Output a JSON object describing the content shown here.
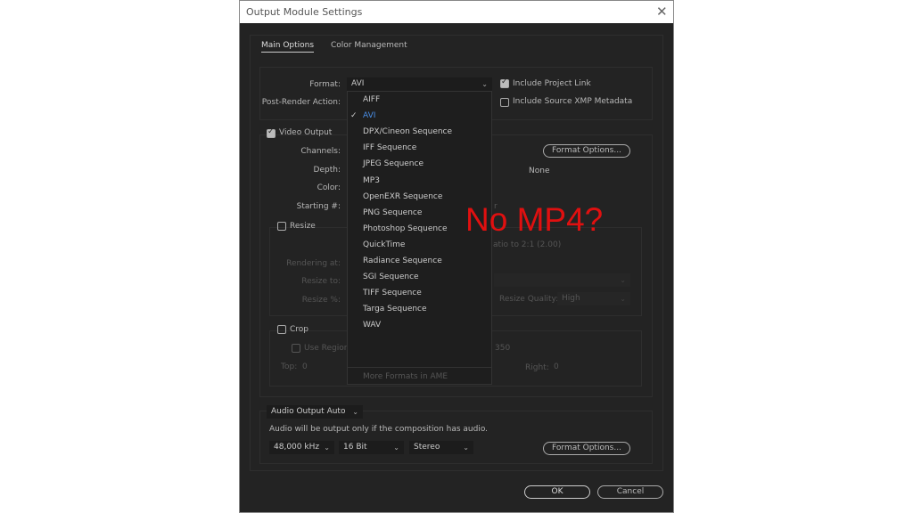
{
  "dialog": {
    "title": "Output Module Settings",
    "close_icon": "close-icon"
  },
  "tabs": [
    {
      "label": "Main Options",
      "active": true
    },
    {
      "label": "Color Management",
      "active": false
    }
  ],
  "format": {
    "label": "Format:",
    "value": "AVI",
    "post_render_label": "Post-Render Action:",
    "include_project_link": {
      "label": "Include Project Link",
      "checked": true
    },
    "include_xmp": {
      "label": "Include Source XMP Metadata",
      "checked": false
    }
  },
  "menu": {
    "items": [
      "AIFF",
      "AVI",
      "DPX/Cineon Sequence",
      "IFF Sequence",
      "JPEG Sequence",
      "MP3",
      "OpenEXR Sequence",
      "PNG Sequence",
      "Photoshop Sequence",
      "QuickTime",
      "Radiance Sequence",
      "SGI Sequence",
      "TIFF Sequence",
      "Targa Sequence",
      "WAV"
    ],
    "selected": "AVI",
    "more": "More Formats in AME"
  },
  "video": {
    "label": "Video Output",
    "checked": true,
    "channels": "Channels:",
    "depth": "Depth:",
    "color": "Color:",
    "starting": "Starting #:",
    "format_options": "Format Options...",
    "none": "None",
    "partial_r": "r"
  },
  "resize": {
    "label": "Resize",
    "checked": false,
    "rendering_at": "Rendering at:",
    "resize_to": "Resize to:",
    "resize_pct": "Resize %:",
    "ratio": "atio to 2:1 (2.00)",
    "quality_label": "Resize Quality:",
    "quality_value": "High"
  },
  "crop": {
    "label": "Crop",
    "checked": false,
    "use_region": "Use Region",
    "partial_value": "350",
    "top_label": "Top:",
    "top_value": "0",
    "right_label": "Right:",
    "right_value": "0"
  },
  "audio": {
    "mode": "Audio Output Auto",
    "note": "Audio will be output only if the composition has audio.",
    "rate": "48,000 kHz",
    "bits": "16 Bit",
    "channels": "Stereo",
    "format_options": "Format Options..."
  },
  "buttons": {
    "ok": "OK",
    "cancel": "Cancel"
  },
  "annotation": {
    "text": "No MP4?",
    "color": "#e01010"
  }
}
